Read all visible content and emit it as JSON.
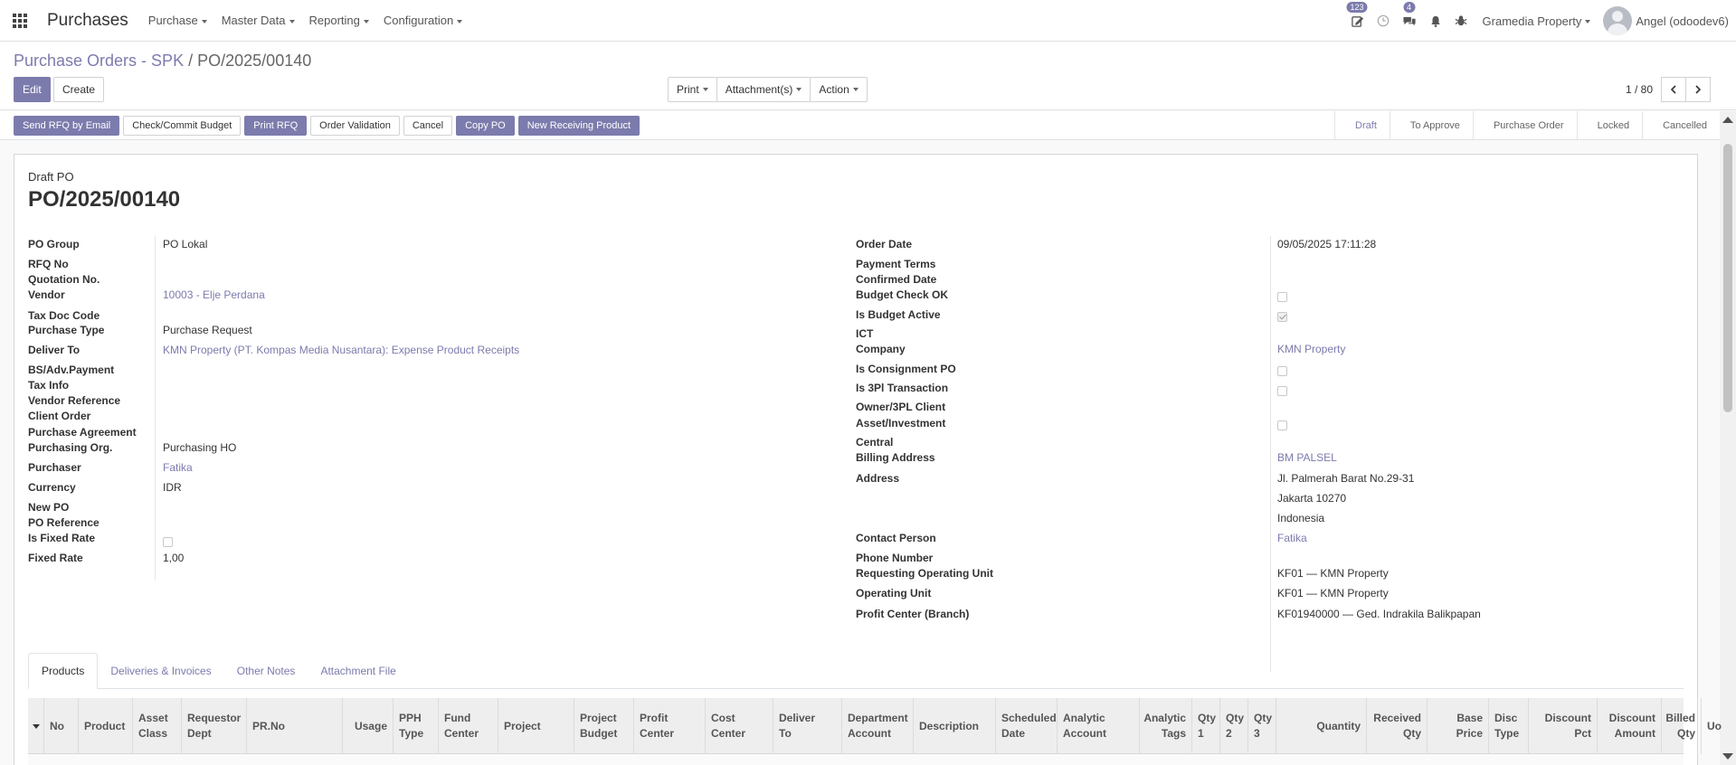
{
  "navbar": {
    "brand": "Purchases",
    "menu": [
      "Purchase",
      "Master Data",
      "Reporting",
      "Configuration"
    ],
    "activity_count": "123",
    "messages_count": "4",
    "company": "Gramedia Property",
    "user": "Angel (odoodev6)"
  },
  "breadcrumb": {
    "parent": "Purchase Orders - SPK",
    "separator": "/",
    "current": "PO/2025/00140"
  },
  "buttons": {
    "edit": "Edit",
    "create": "Create",
    "print": "Print",
    "attachments": "Attachment(s)",
    "action": "Action"
  },
  "pager": {
    "value": "1 / 80"
  },
  "header_actions": [
    "Send RFQ by Email",
    "Check/Commit Budget",
    "Print RFQ",
    "Order Validation",
    "Cancel",
    "Copy PO",
    "New Receiving Product"
  ],
  "stages": [
    "Draft",
    "To Approve",
    "Purchase Order",
    "Locked",
    "Cancelled"
  ],
  "colors": {
    "accent": "#7c7bad",
    "navbar_bg": "#ffffff",
    "table_header_bg": "#eeeeee"
  },
  "sheet": {
    "doc_type": "Draft PO",
    "doc_name": "PO/2025/00140",
    "left_fields": {
      "po_group": {
        "label": "PO Group",
        "value": "PO Lokal"
      },
      "rfq_no": {
        "label": "RFQ No",
        "value": ""
      },
      "quotation_no": {
        "label": "Quotation No.",
        "value": ""
      },
      "vendor": {
        "label": "Vendor",
        "value": "10003 - Elje Perdana"
      },
      "tax_doc_code": {
        "label": "Tax Doc Code",
        "value": ""
      },
      "purchase_type": {
        "label": "Purchase Type",
        "value": "Purchase Request"
      },
      "deliver_to": {
        "label": "Deliver To",
        "value": "KMN Property (PT. Kompas Media Nusantara): Expense Product Receipts"
      },
      "bs_adv_payment": {
        "label": "BS/Adv.Payment",
        "value": ""
      },
      "tax_info": {
        "label": "Tax Info",
        "value": ""
      },
      "vendor_reference": {
        "label": "Vendor Reference",
        "value": ""
      },
      "client_order": {
        "label": "Client Order",
        "value": ""
      },
      "purchase_agreement": {
        "label": "Purchase Agreement",
        "value": ""
      },
      "purchasing_org": {
        "label": "Purchasing Org.",
        "value": "Purchasing HO"
      },
      "purchaser": {
        "label": "Purchaser",
        "value": "Fatika"
      },
      "currency": {
        "label": "Currency",
        "value": "IDR"
      },
      "new_po": {
        "label": "New PO",
        "value": ""
      },
      "po_reference": {
        "label": "PO Reference",
        "value": ""
      },
      "is_fixed_rate": {
        "label": "Is Fixed Rate",
        "checked": false
      },
      "fixed_rate": {
        "label": "Fixed Rate",
        "value": "1,00"
      }
    },
    "right_fields": {
      "order_date": {
        "label": "Order Date",
        "value": "09/05/2025 17:11:28"
      },
      "payment_terms": {
        "label": "Payment Terms",
        "value": ""
      },
      "confirmed_date": {
        "label": "Confirmed Date",
        "value": ""
      },
      "budget_check_ok": {
        "label": "Budget Check OK",
        "checked": false
      },
      "is_budget_active": {
        "label": "Is Budget Active",
        "checked": true
      },
      "ict": {
        "label": "ICT",
        "value": ""
      },
      "company": {
        "label": "Company",
        "value": "KMN Property"
      },
      "is_consignment_po": {
        "label": "Is Consignment PO",
        "checked": false
      },
      "is_3pl_transaction": {
        "label": "Is 3Pl Transaction",
        "checked": false
      },
      "owner_3pl_client": {
        "label": "Owner/3PL Client",
        "value": ""
      },
      "asset_investment": {
        "label": "Asset/Investment",
        "checked": false
      },
      "central": {
        "label": "Central",
        "value": ""
      },
      "billing_address": {
        "label": "Billing Address",
        "value": "BM PALSEL"
      },
      "address": {
        "label": "Address",
        "line1": "Jl. Palmerah Barat No.29-31",
        "line2": "Jakarta  10270",
        "line3": "Indonesia"
      },
      "contact_person": {
        "label": "Contact Person",
        "value": "Fatika"
      },
      "phone_number": {
        "label": "Phone Number",
        "value": ""
      },
      "requesting_operating_unit": {
        "label": "Requesting Operating Unit",
        "value": "KF01 — KMN Property"
      },
      "operating_unit": {
        "label": "Operating Unit",
        "value": "KF01 — KMN Property"
      },
      "profit_center": {
        "label": "Profit Center (Branch)",
        "value": "KF01940000 — Ged. Indrakila Balikpapan"
      }
    }
  },
  "tabs": [
    "Products",
    "Deliveries & Invoices",
    "Other Notes",
    "Attachment File"
  ],
  "table": {
    "columns": [
      {
        "l1": "No",
        "l2": ""
      },
      {
        "l1": "Product",
        "l2": ""
      },
      {
        "l1": "Asset",
        "l2": "Class"
      },
      {
        "l1": "Requestor",
        "l2": "Dept"
      },
      {
        "l1": "PR.No",
        "l2": ""
      },
      {
        "l1": "Usage",
        "l2": ""
      },
      {
        "l1": "PPH",
        "l2": "Type"
      },
      {
        "l1": "Fund",
        "l2": "Center"
      },
      {
        "l1": "Project",
        "l2": ""
      },
      {
        "l1": "Project",
        "l2": "Budget"
      },
      {
        "l1": "Profit",
        "l2": "Center"
      },
      {
        "l1": "Cost",
        "l2": "Center"
      },
      {
        "l1": "Deliver",
        "l2": "To"
      },
      {
        "l1": "Department",
        "l2": "Account"
      },
      {
        "l1": "Description",
        "l2": ""
      },
      {
        "l1": "Scheduled",
        "l2": "Date"
      },
      {
        "l1": "Analytic",
        "l2": "Account"
      },
      {
        "l1": "Analytic",
        "l2": "Tags"
      },
      {
        "l1": "Qty",
        "l2": "1"
      },
      {
        "l1": "Qty",
        "l2": "2"
      },
      {
        "l1": "Qty",
        "l2": "3"
      },
      {
        "l1": "Quantity",
        "l2": ""
      },
      {
        "l1": "Received",
        "l2": "Qty"
      },
      {
        "l1": "Base",
        "l2": "Price"
      },
      {
        "l1": "Disc",
        "l2": "Type"
      },
      {
        "l1": "Discount",
        "l2": "Pct"
      },
      {
        "l1": "Discount",
        "l2": "Amount"
      },
      {
        "l1": "Billed",
        "l2": "Qty"
      },
      {
        "l1": "Uo",
        "l2": ""
      }
    ]
  }
}
